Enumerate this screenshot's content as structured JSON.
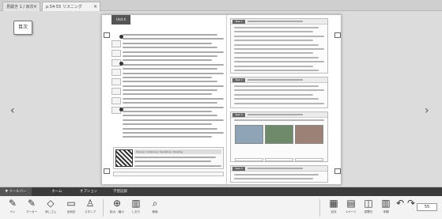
{
  "tabs": [
    {
      "label": "見開き 1 / 目次",
      "active": false
    },
    {
      "label": "p.54-55 リスニング",
      "active": true
    }
  ],
  "tab_close_glyph": "×",
  "toc_button": {
    "label": "目次"
  },
  "nav": {
    "prev_icon": "chevron-left-icon",
    "next_icon": "chevron-right-icon",
    "prev_glyph": "‹",
    "next_glyph": "›"
  },
  "book": {
    "unit_badge": "Unit 4",
    "footer_label": "Scenes / Listening / Speaking / Reading"
  },
  "right_page": {
    "section_tags": [
      "Task 1",
      "Task 2",
      "Task 3",
      "Task 4"
    ]
  },
  "toolbar": {
    "tabs": [
      {
        "label": "▼ ツールバー",
        "active": true
      },
      {
        "label": "ホーム",
        "active": false
      },
      {
        "label": "オプション",
        "active": false
      },
      {
        "label": "学習記録",
        "active": false
      }
    ],
    "left_tools": [
      {
        "name": "pen-tool",
        "glyph": "✎",
        "label": "ペン"
      },
      {
        "name": "marker-tool",
        "glyph": "✎",
        "label": "マーカー"
      },
      {
        "name": "eraser-tool",
        "glyph": "◇",
        "label": "消しゴム"
      },
      {
        "name": "clear-tool",
        "glyph": "▭",
        "label": "全消去"
      },
      {
        "name": "stamp-tool",
        "glyph": "♙",
        "label": "スタンプ"
      },
      {
        "name": "zoom-in-tool",
        "glyph": "⊕",
        "label": "拡大・縮小"
      },
      {
        "name": "shield-tool",
        "glyph": "▥",
        "label": "しおり"
      },
      {
        "name": "search-tool",
        "glyph": "⌕",
        "label": "検索"
      }
    ],
    "right_tools": [
      {
        "name": "grid-tool",
        "glyph": "▦",
        "label": "目次"
      },
      {
        "name": "page-view-tool",
        "glyph": "▤",
        "label": "1ページ"
      },
      {
        "name": "spread-view-tool",
        "glyph": "◫",
        "label": "見開き"
      },
      {
        "name": "bookshelf-tool",
        "glyph": "▥",
        "label": "本棚"
      },
      {
        "name": "undo-tool",
        "glyph": "↶",
        "label": ""
      },
      {
        "name": "redo-tool",
        "glyph": "↷",
        "label": ""
      }
    ],
    "page_field": "55"
  }
}
